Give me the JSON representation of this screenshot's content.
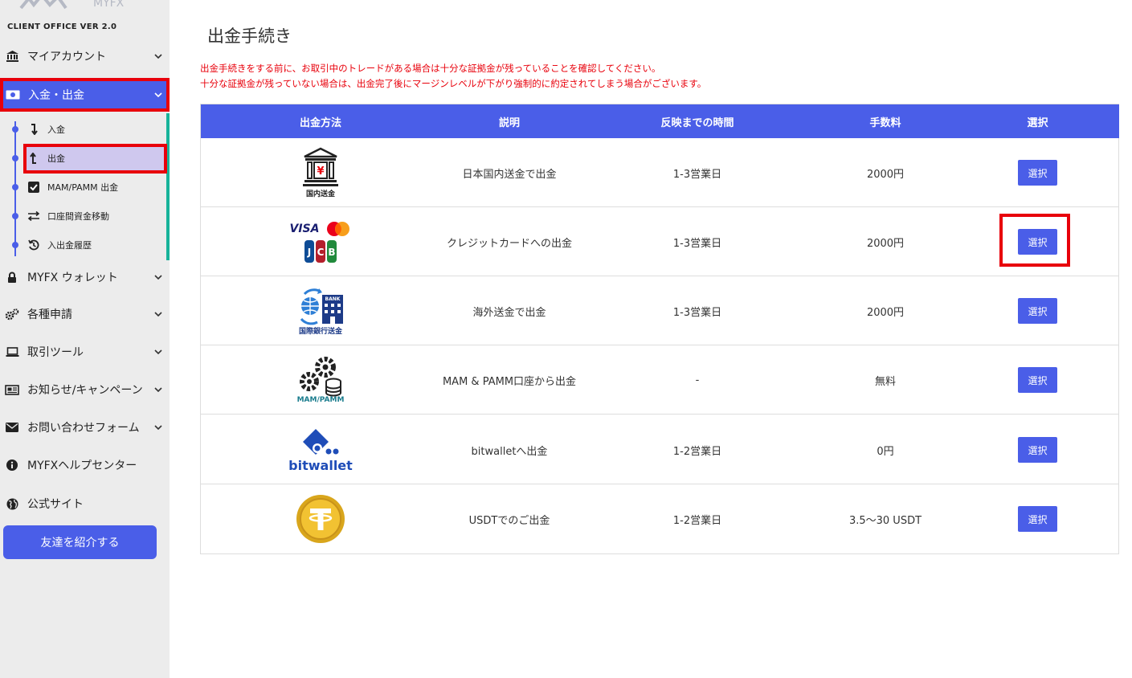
{
  "sidebar": {
    "version": "CLIENT OFFICE VER 2.0",
    "items": [
      {
        "label": "マイアカウント",
        "icon": "bank-icon"
      },
      {
        "label": "入金・出金",
        "icon": "cash-icon"
      },
      {
        "label": "MYFX ウォレット",
        "icon": "lock-icon"
      },
      {
        "label": "各種申請",
        "icon": "gears-icon"
      },
      {
        "label": "取引ツール",
        "icon": "laptop-icon"
      },
      {
        "label": "お知らせ/キャンペーン",
        "icon": "newspaper-icon"
      },
      {
        "label": "お問い合わせフォーム",
        "icon": "envelope-icon"
      },
      {
        "label": "MYFXヘルプセンター",
        "icon": "info-icon"
      },
      {
        "label": "公式サイト",
        "icon": "globe-icon"
      }
    ],
    "subitems": [
      {
        "label": "入金",
        "icon": "arrow-down-icon"
      },
      {
        "label": "出金",
        "icon": "arrow-up-icon"
      },
      {
        "label": "MAM/PAMM 出金",
        "icon": "checkbox-icon"
      },
      {
        "label": "口座間資金移動",
        "icon": "transfer-icon"
      },
      {
        "label": "入出金履歴",
        "icon": "history-icon"
      }
    ],
    "refer_button": "友達を紹介する"
  },
  "main": {
    "title": "出金手続き",
    "warning1": "出金手続きをする前に、お取引中のトレードがある場合は十分な証拠金が残っていることを確認してください。",
    "warning2": "十分な証拠金が残っていない場合は、出金完了後にマージンレベルが下がり強制的に約定されてしまう場合がございます。",
    "table": {
      "headers": [
        "出金方法",
        "説明",
        "反映までの時間",
        "手数料",
        "選択"
      ],
      "rows": [
        {
          "logo_text": "国内送金",
          "description": "日本国内送金で出金",
          "time": "1-3営業日",
          "fee": "2000円",
          "button": "選択"
        },
        {
          "logo_text": "VISA",
          "description": "クレジットカードへの出金",
          "time": "1-3営業日",
          "fee": "2000円",
          "button": "選択"
        },
        {
          "logo_text": "国際銀行送金",
          "description": "海外送金で出金",
          "time": "1-3営業日",
          "fee": "2000円",
          "button": "選択"
        },
        {
          "logo_text": "MAM/PAMM",
          "description": "MAM & PAMM口座から出金",
          "time": "-",
          "fee": "無料",
          "button": "選択"
        },
        {
          "logo_text": "bitwallet",
          "description": "bitwalletへ出金",
          "time": "1-2営業日",
          "fee": "0円",
          "button": "選択"
        },
        {
          "logo_text": "",
          "description": "USDTでのご出金",
          "time": "1-2営業日",
          "fee": "3.5～30 USDT",
          "button": "選択"
        }
      ]
    }
  },
  "colors": {
    "accent": "#4a5ee8",
    "highlight": "#e8000b",
    "rail_green": "#17b39a"
  }
}
